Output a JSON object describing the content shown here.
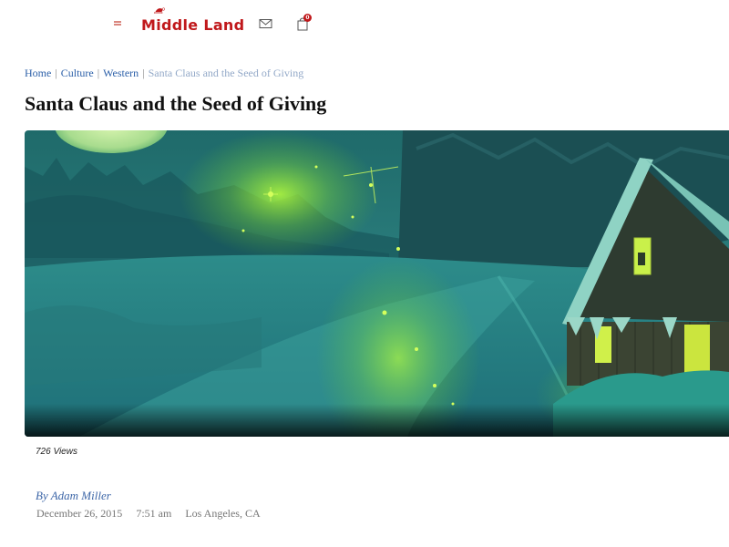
{
  "header": {
    "logo_text": "Middle Land",
    "cart_count": "0"
  },
  "breadcrumb": {
    "items": [
      "Home",
      "Culture",
      "Western"
    ],
    "current": "Santa Claus and the Seed of Giving"
  },
  "article": {
    "title": "Santa Claus and the Seed of Giving",
    "views": "726 Views",
    "author": "By Adam Miller",
    "date": "December 26, 2015",
    "time": "7:51 am",
    "location": "Los Angeles, CA"
  },
  "colors": {
    "brand": "#c0181b",
    "link": "#2b5fa8"
  },
  "icons": [
    "menu-icon",
    "mail-icon",
    "cart-icon"
  ]
}
